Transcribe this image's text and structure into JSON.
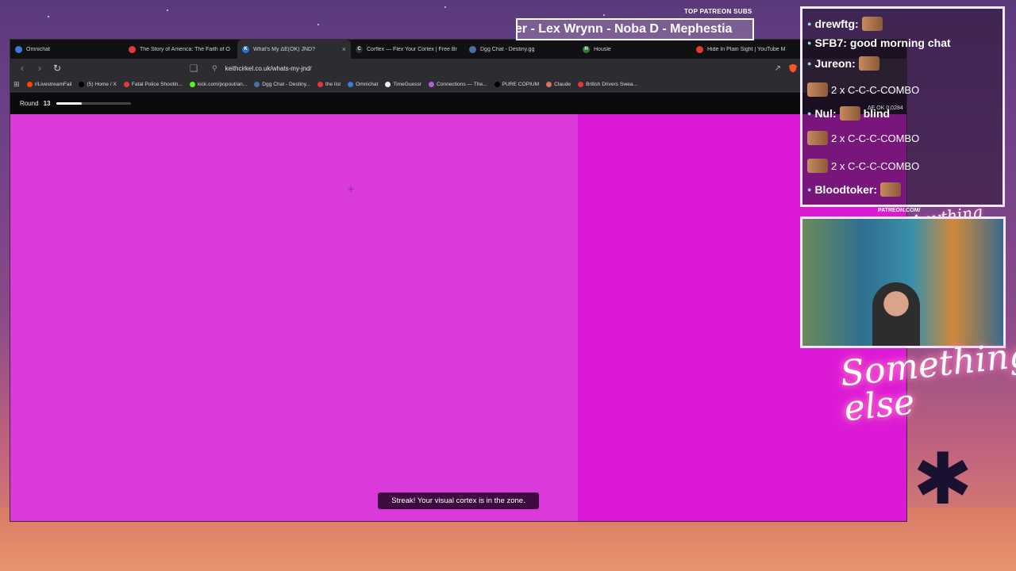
{
  "tabs": [
    {
      "title": "Omnichat",
      "fav_color": "#3a7bd5",
      "fav": "",
      "active": false
    },
    {
      "title": "The Story of America: The Faith of O",
      "fav_color": "#e53935",
      "fav": "",
      "active": false
    },
    {
      "title": "What's My ΔE(OK) JND?",
      "fav_color": "#2a6fd6",
      "fav": "K",
      "active": true
    },
    {
      "title": "Corflex — Flex Your Cortex | Free Br",
      "fav_color": "#333333",
      "fav": "C",
      "active": false
    },
    {
      "title": "Dgg Chat - Destiny.gg",
      "fav_color": "#4a6fa5",
      "fav": "",
      "active": false
    },
    {
      "title": "Housle",
      "fav_color": "#2e7d32",
      "fav": "H",
      "active": false
    },
    {
      "title": "Hide In Plain Sight | YouTube M",
      "fav_color": "#e53935",
      "fav": "",
      "active": false
    }
  ],
  "address": {
    "url": "keithcirkel.co.uk/whats-my-jnd/"
  },
  "bookmarks": [
    {
      "label": "r/LivestreamFail",
      "color": "#ff4500"
    },
    {
      "label": "(5) Home / X",
      "color": "#000000"
    },
    {
      "label": "Fatal Police Shootin...",
      "color": "#e53935"
    },
    {
      "label": "kick.com/popout/an...",
      "color": "#53fc18"
    },
    {
      "label": "Dgg Chat - Destiny...",
      "color": "#4a6fa5"
    },
    {
      "label": "the list",
      "color": "#e53935"
    },
    {
      "label": "Omnichat",
      "color": "#3a7bd5"
    },
    {
      "label": "TimeGuessr",
      "color": "#eeeeee"
    },
    {
      "label": "Connections — The...",
      "color": "#b35fd6"
    },
    {
      "label": "PURE COPIUM",
      "color": "#000000"
    },
    {
      "label": "Claude",
      "color": "#d97757"
    },
    {
      "label": "British Drivers Swea...",
      "color": "#e53935"
    }
  ],
  "round": {
    "label": "Round",
    "number": "13",
    "progress": 0.33
  },
  "swatches": {
    "left_color": "#d93ad9",
    "right_color": "#dc1ad6"
  },
  "toast": "Streak! Your visual cortex is in the zone.",
  "overlay": {
    "patreon_label": "TOP PATREON SUBS",
    "ticker": "yer - Lex Wrynn -  Noba D - Mephestia",
    "patreon_url": "PATREON.COM/",
    "logo": "Something else",
    "logo_small": "Anything else"
  },
  "chat": [
    {
      "user": "drewftg:",
      "msg": "",
      "emote": true,
      "combo": ""
    },
    {
      "user": "SFB7:",
      "msg": "good morning chat",
      "emote": false,
      "combo": ""
    },
    {
      "user": "Jureon:",
      "msg": "",
      "emote": true,
      "combo": ""
    },
    {
      "user": "",
      "msg": "",
      "emote": true,
      "combo": "2 x C-C-C-COMBO"
    },
    {
      "user": "Nul:",
      "msg": "blind",
      "emote": true,
      "combo": ""
    },
    {
      "user": "",
      "msg": "",
      "emote": true,
      "combo": "2 x C-C-C-COMBO"
    },
    {
      "user": "",
      "msg": "",
      "emote": true,
      "combo": "2 x  C-C-C-COMBO"
    },
    {
      "user": "Bloodtoker:",
      "msg": "",
      "emote": true,
      "combo": ""
    }
  ],
  "chat_meta": "ΔE OK 0.0284"
}
